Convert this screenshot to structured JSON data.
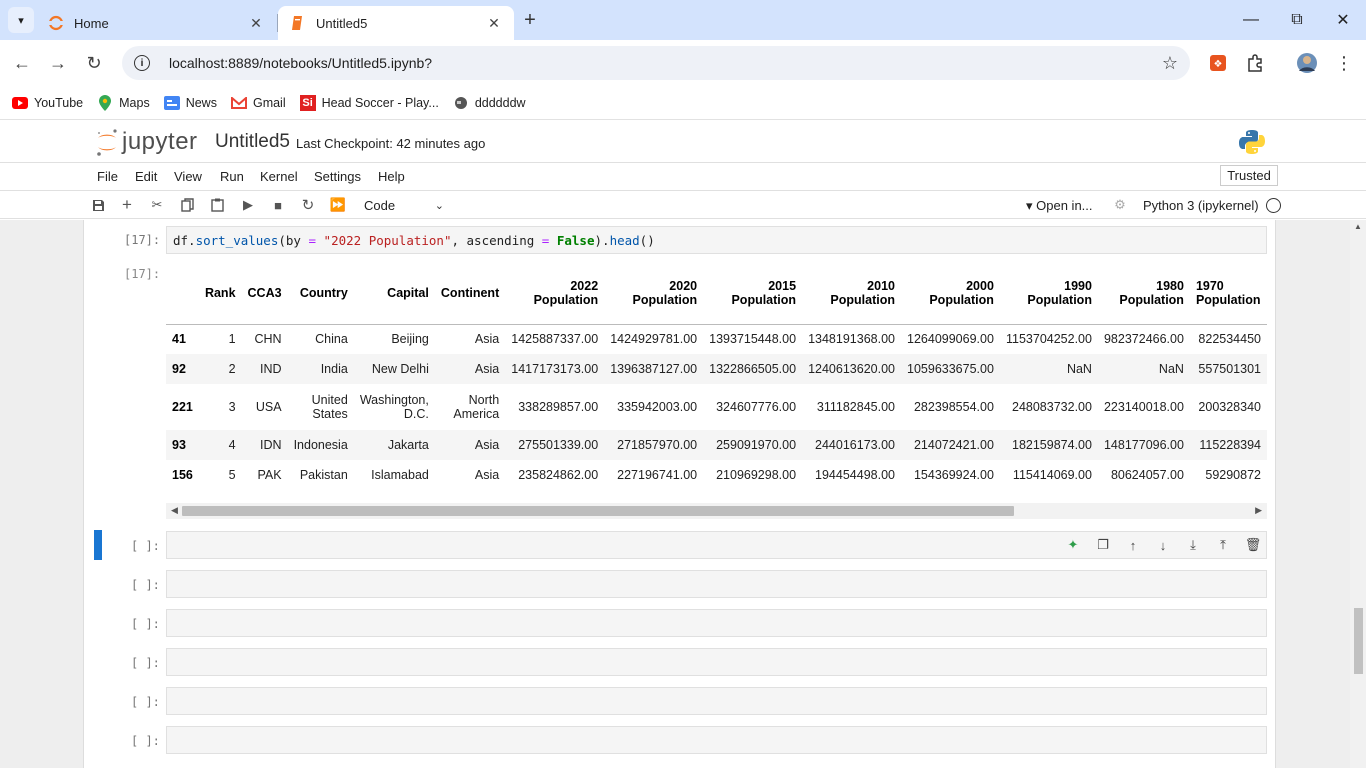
{
  "browser": {
    "tabs": [
      {
        "title": "Home",
        "active": false
      },
      {
        "title": "Untitled5",
        "active": true
      }
    ],
    "url": "localhost:8889/notebooks/Untitled5.ipynb?",
    "bookmarks": [
      "YouTube",
      "Maps",
      "News",
      "Gmail",
      "Head Soccer - Play...",
      "ddddddw"
    ]
  },
  "jupyter": {
    "logo_text": "jupyter",
    "notebook_title": "Untitled5",
    "checkpoint": "Last Checkpoint: 42 minutes ago",
    "menu": [
      "File",
      "Edit",
      "View",
      "Run",
      "Kernel",
      "Settings",
      "Help"
    ],
    "trusted": "Trusted",
    "cell_type": "Code",
    "open_in": "Open in...",
    "kernel": "Python 3 (ipykernel)"
  },
  "cells": {
    "code_prompt": "[17]:",
    "out_prompt": "[17]:",
    "code_parts": {
      "p1": "df.",
      "p2": "sort_values",
      "p3": "(by ",
      "p4": "=",
      "p5": " ",
      "p6": "\"2022 Population\"",
      "p7": ", ascending ",
      "p8": "=",
      "p9": " ",
      "p10": "False",
      "p11": ").",
      "p12": "head",
      "p13": "()"
    },
    "empty_prompt": "[ ]:"
  },
  "table": {
    "headers": [
      "",
      "Rank",
      "CCA3",
      "Country",
      "Capital",
      "Continent",
      "2022 Population",
      "2020 Population",
      "2015 Population",
      "2010 Population",
      "2000 Population",
      "1990 Population",
      "1980 Population",
      "1970 Population"
    ],
    "rows": [
      [
        "41",
        "1",
        "CHN",
        "China",
        "Beijing",
        "Asia",
        "1425887337.00",
        "1424929781.00",
        "1393715448.00",
        "1348191368.00",
        "1264099069.00",
        "1153704252.00",
        "982372466.00",
        "822534450"
      ],
      [
        "92",
        "2",
        "IND",
        "India",
        "New Delhi",
        "Asia",
        "1417173173.00",
        "1396387127.00",
        "1322866505.00",
        "1240613620.00",
        "1059633675.00",
        "NaN",
        "NaN",
        "557501301"
      ],
      [
        "221",
        "3",
        "USA",
        "United States",
        "Washington, D.C.",
        "North America",
        "338289857.00",
        "335942003.00",
        "324607776.00",
        "311182845.00",
        "282398554.00",
        "248083732.00",
        "223140018.00",
        "200328340"
      ],
      [
        "93",
        "4",
        "IDN",
        "Indonesia",
        "Jakarta",
        "Asia",
        "275501339.00",
        "271857970.00",
        "259091970.00",
        "244016173.00",
        "214072421.00",
        "182159874.00",
        "148177096.00",
        "115228394"
      ],
      [
        "156",
        "5",
        "PAK",
        "Pakistan",
        "Islamabad",
        "Asia",
        "235824862.00",
        "227196741.00",
        "210969298.00",
        "194454498.00",
        "154369924.00",
        "115414069.00",
        "80624057.00",
        "59290872"
      ]
    ]
  },
  "colors": {
    "tabstrip": "#d3e3fd",
    "active_cell_bar": "#1976d2",
    "jupyter_orange": "#f37726"
  }
}
